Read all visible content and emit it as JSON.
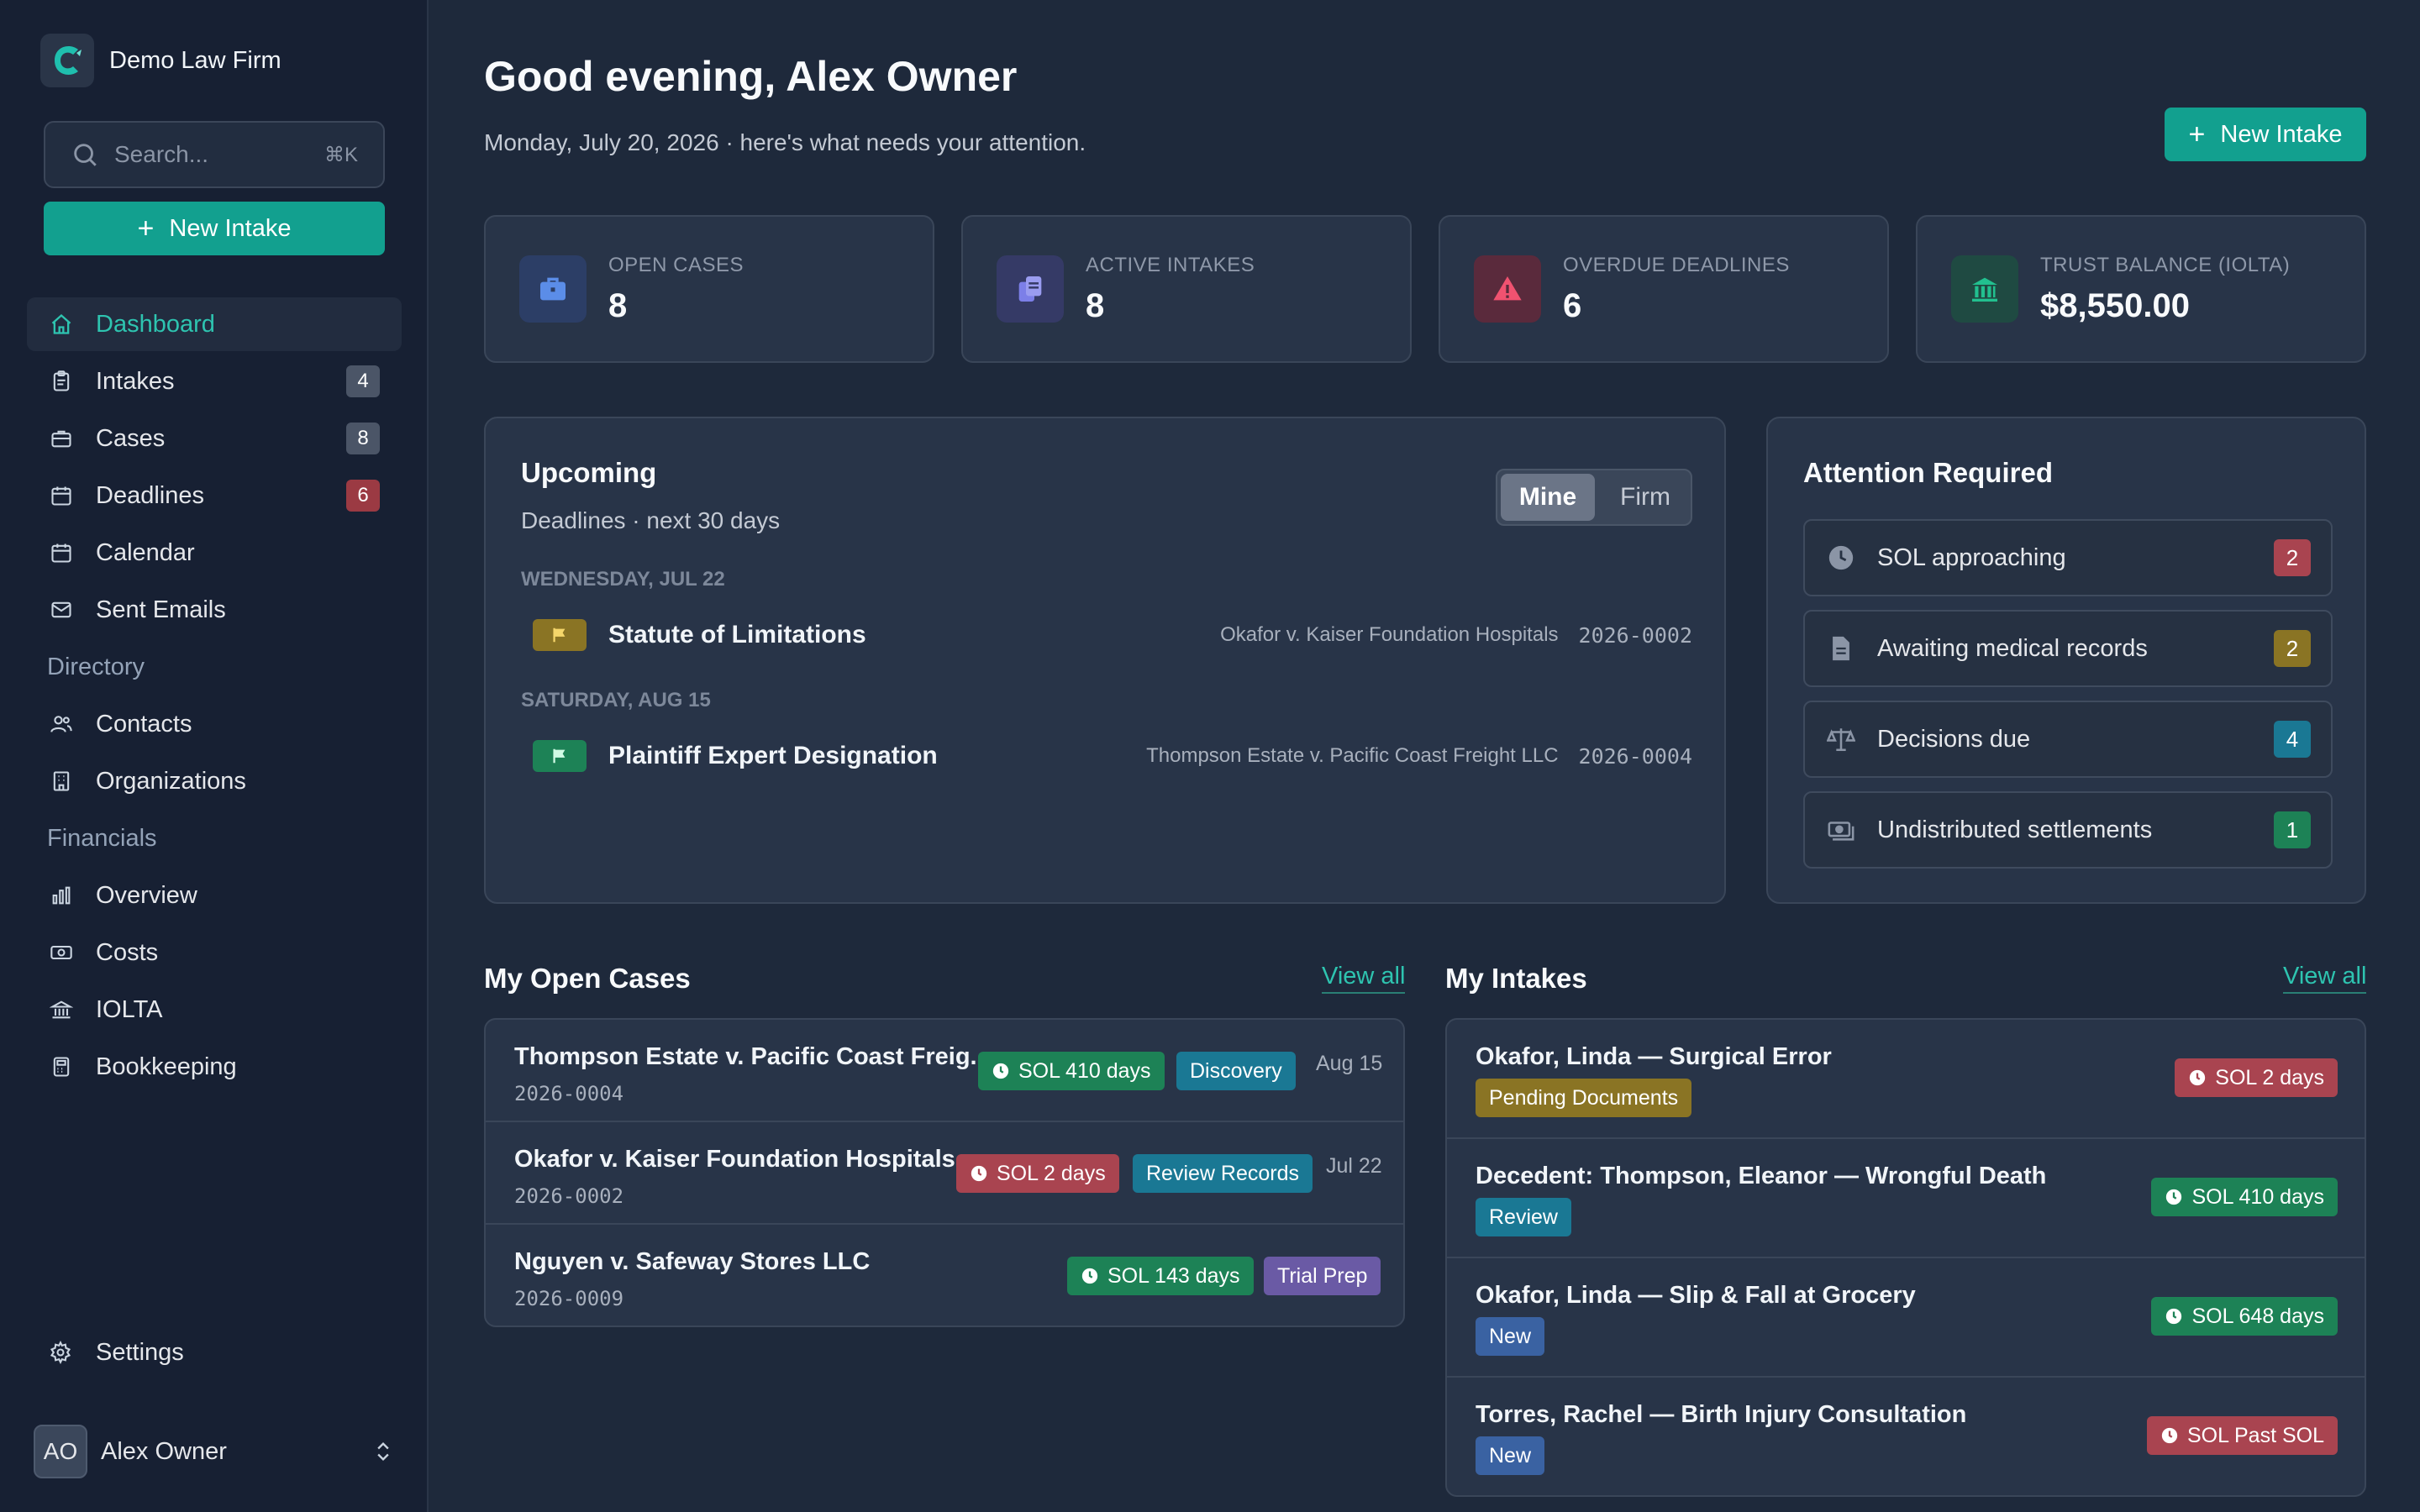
{
  "colors": {
    "accent": "#12a08f",
    "accent_text": "#2ec4b0",
    "sidebar_bg": "#172033",
    "main_bg": "#1e293b",
    "card_bg": "#283448"
  },
  "sidebar": {
    "firm_name": "Demo Law Firm",
    "search_placeholder": "Search...",
    "search_shortcut": "⌘K",
    "new_intake": "New Intake",
    "items": [
      {
        "label": "Dashboard",
        "icon": "home-icon",
        "active": true
      },
      {
        "label": "Intakes",
        "icon": "clipboard-icon",
        "count": "4"
      },
      {
        "label": "Cases",
        "icon": "briefcase-icon",
        "count": "8"
      },
      {
        "label": "Deadlines",
        "icon": "calendar-icon",
        "count": "6"
      },
      {
        "label": "Calendar",
        "icon": "calendar-icon"
      },
      {
        "label": "Sent Emails",
        "icon": "mail-icon"
      }
    ],
    "directory_label": "Directory",
    "directory_items": [
      {
        "label": "Contacts",
        "icon": "users-icon"
      },
      {
        "label": "Organizations",
        "icon": "building-icon"
      }
    ],
    "financials_label": "Financials",
    "financial_items": [
      {
        "label": "Overview",
        "icon": "bar-chart-icon"
      },
      {
        "label": "Costs",
        "icon": "banknote-icon"
      },
      {
        "label": "IOLTA",
        "icon": "bank-icon"
      },
      {
        "label": "Bookkeeping",
        "icon": "calculator-icon"
      }
    ],
    "settings_label": "Settings",
    "user_initials": "AO",
    "user_name": "Alex Owner"
  },
  "header": {
    "greeting": "Good evening, Alex Owner",
    "date_line": "Monday, July 20, 2026 · here's what needs your attention.",
    "new_intake": "New Intake"
  },
  "stats": [
    {
      "label": "OPEN CASES",
      "value": "8",
      "icon": "briefcase-icon"
    },
    {
      "label": "ACTIVE INTAKES",
      "value": "8",
      "icon": "clipboard-icon"
    },
    {
      "label": "OVERDUE DEADLINES",
      "value": "6",
      "icon": "warning-icon"
    },
    {
      "label": "TRUST BALANCE (IOLTA)",
      "value": "$8,550.00",
      "icon": "bank-icon"
    }
  ],
  "upcoming": {
    "title": "Upcoming",
    "subtitle": "Deadlines · next 30 days",
    "toggle": {
      "mine": "Mine",
      "firm": "Firm",
      "selected": "Mine"
    },
    "groups": [
      {
        "day": "WEDNESDAY, JUL 22",
        "items": [
          {
            "title": "Statute of Limitations",
            "case": "Okafor v. Kaiser Foundation Hospitals",
            "number": "2026-0002"
          }
        ]
      },
      {
        "day": "SATURDAY, AUG 15",
        "items": [
          {
            "title": "Plaintiff Expert Designation",
            "case": "Thompson Estate v. Pacific Coast Freight LLC",
            "number": "2026-0004"
          }
        ]
      }
    ]
  },
  "attention": {
    "title": "Attention Required",
    "items": [
      {
        "label": "SOL approaching",
        "count": "2",
        "icon": "clock-icon"
      },
      {
        "label": "Awaiting medical records",
        "count": "2",
        "icon": "document-icon"
      },
      {
        "label": "Decisions due",
        "count": "4",
        "icon": "scale-icon"
      },
      {
        "label": "Undistributed settlements",
        "count": "1",
        "icon": "money-icon"
      }
    ]
  },
  "open_cases": {
    "title": "My Open Cases",
    "view_all": "View all",
    "rows": [
      {
        "title": "Thompson Estate v. Pacific Coast Freig...",
        "number": "2026-0004",
        "sol": "SOL 410 days",
        "stage": "Discovery",
        "date": "Aug 15"
      },
      {
        "title": "Okafor v. Kaiser Foundation Hospitals",
        "number": "2026-0002",
        "sol": "SOL 2 days",
        "stage": "Review Records",
        "date": "Jul 22"
      },
      {
        "title": "Nguyen v. Safeway Stores LLC",
        "number": "2026-0009",
        "sol": "SOL 143 days",
        "stage": "Trial Prep",
        "date": ""
      }
    ]
  },
  "intakes": {
    "title": "My Intakes",
    "view_all": "View all",
    "rows": [
      {
        "title": "Okafor, Linda — Surgical Error",
        "status": "Pending Documents",
        "sol": "SOL 2 days"
      },
      {
        "title": "Decedent: Thompson, Eleanor — Wrongful Death",
        "status": "Review",
        "sol": "SOL 410 days"
      },
      {
        "title": "Okafor, Linda — Slip & Fall at Grocery",
        "status": "New",
        "sol": "SOL 648 days"
      },
      {
        "title": "Torres, Rachel — Birth Injury Consultation",
        "status": "New",
        "sol": "SOL Past SOL"
      }
    ]
  }
}
